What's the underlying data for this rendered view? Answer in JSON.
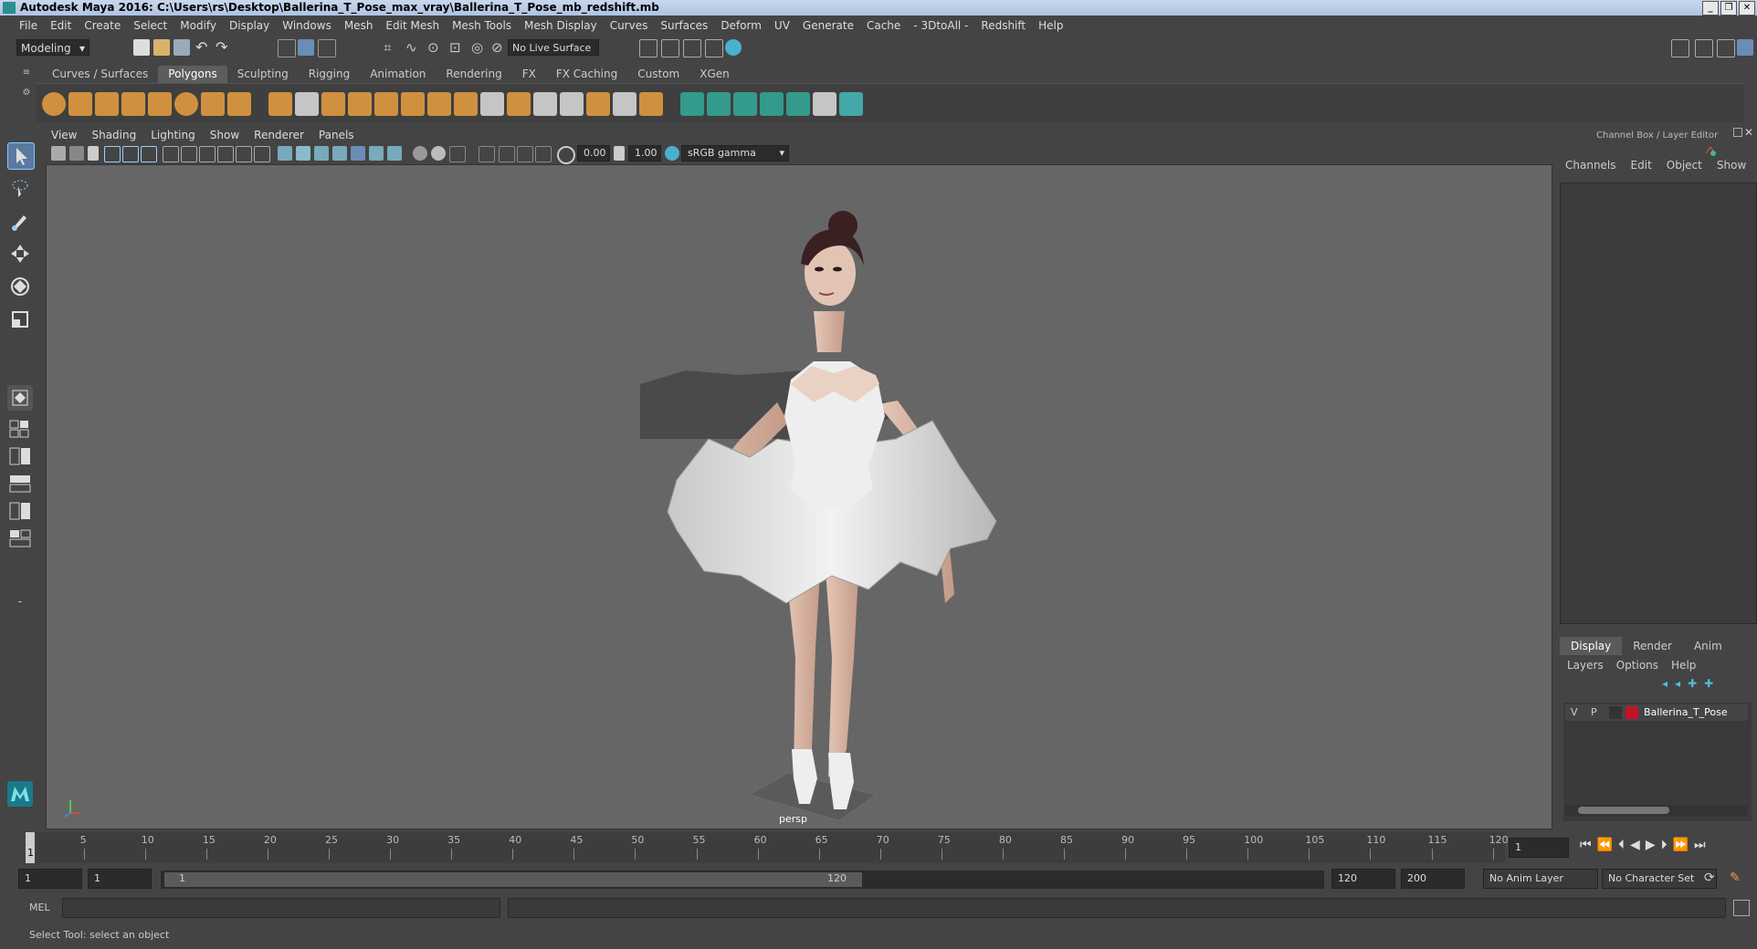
{
  "window": {
    "title": "Autodesk Maya 2016: C:\\Users\\rs\\Desktop\\Ballerina_T_Pose_max_vray\\Ballerina_T_Pose_mb_redshift.mb",
    "minimize": "_",
    "restore": "❐",
    "close": "✕"
  },
  "menubar": [
    "File",
    "Edit",
    "Create",
    "Select",
    "Modify",
    "Display",
    "Windows",
    "Mesh",
    "Edit Mesh",
    "Mesh Tools",
    "Mesh Display",
    "Curves",
    "Surfaces",
    "Deform",
    "UV",
    "Generate",
    "Cache",
    "- 3DtoAll -",
    "Redshift",
    "Help"
  ],
  "statusline": {
    "mode": "Modeling",
    "live_surface": "No Live Surface"
  },
  "shelf_tabs": [
    "Curves / Surfaces",
    "Polygons",
    "Sculpting",
    "Rigging",
    "Animation",
    "Rendering",
    "FX",
    "FX Caching",
    "Custom",
    "XGen"
  ],
  "shelf_active": "Polygons",
  "viewport_menu": [
    "View",
    "Shading",
    "Lighting",
    "Show",
    "Renderer",
    "Panels"
  ],
  "viewport_tools": {
    "exposure": "0.00",
    "gamma": "1.00",
    "colorspace": "sRGB gamma"
  },
  "viewport": {
    "camera_label": "persp"
  },
  "right_panel": {
    "title": "Channel Box / Layer Editor",
    "channel_menu": [
      "Channels",
      "Edit",
      "Object",
      "Show"
    ],
    "layer_tabs": [
      "Display",
      "Render",
      "Anim"
    ],
    "layer_active": "Display",
    "layer_menu": [
      "Layers",
      "Options",
      "Help"
    ],
    "layer": {
      "visible": "V",
      "playback": "P",
      "name": "Ballerina_T_Pose",
      "color": "#c0142c"
    }
  },
  "timeline": {
    "ticks": [
      "5",
      "10",
      "15",
      "20",
      "25",
      "30",
      "35",
      "40",
      "45",
      "50",
      "55",
      "60",
      "65",
      "70",
      "75",
      "80",
      "85",
      "90",
      "95",
      "100",
      "105",
      "110",
      "115",
      "120"
    ],
    "current_frame": "1",
    "start_marker": "1"
  },
  "range": {
    "start": "1",
    "playback_start": "1",
    "slider_start": "1",
    "slider_end": "120",
    "playback_end": "120",
    "end": "200",
    "anim_layer": "No Anim Layer",
    "character_set": "No Character Set"
  },
  "command": {
    "label": "MEL"
  },
  "helpline": "Select Tool: select an object"
}
